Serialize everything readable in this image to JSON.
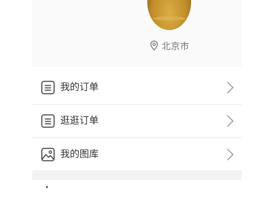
{
  "profile": {
    "location": "北京市",
    "location_icon": "location-pin-icon",
    "avatar_color": "#c9962f"
  },
  "menu": {
    "items": [
      {
        "label": "我的订单",
        "icon": "order-list-icon"
      },
      {
        "label": "逛逛订单",
        "icon": "browse-orders-icon"
      },
      {
        "label": "我的图库",
        "icon": "gallery-image-icon"
      }
    ]
  },
  "colors": {
    "text_primary": "#333333",
    "text_secondary": "#777777",
    "divider": "#ececec",
    "section_gap": "#f2f2f2"
  }
}
